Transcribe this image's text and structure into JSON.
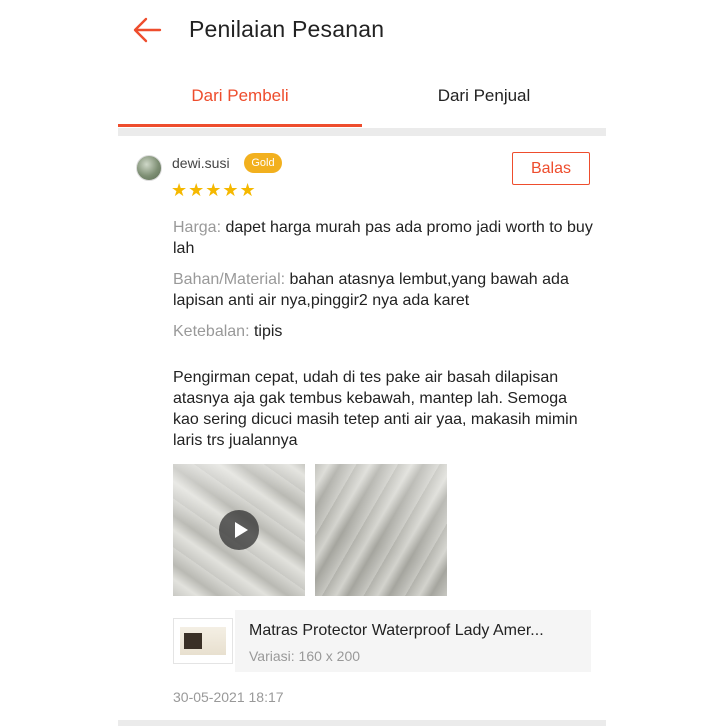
{
  "header": {
    "title": "Penilaian Pesanan",
    "back_icon": "arrow-left-icon",
    "accent_color": "#ee4d2d"
  },
  "tabs": [
    {
      "label": "Dari Pembeli",
      "active": true
    },
    {
      "label": "Dari Penjual",
      "active": false
    }
  ],
  "review": {
    "username": "dewi.susi",
    "badge": "Gold",
    "rating": 5,
    "stars": "★★★★★",
    "reply_label": "Balas",
    "attributes": [
      {
        "label": "Harga:",
        "value": "dapet harga murah pas ada promo jadi worth to buy lah"
      },
      {
        "label": "Bahan/Material:",
        "value": "bahan atasnya lembut,yang bawah ada lapisan anti air nya,pinggir2 nya ada karet"
      },
      {
        "label": "Ketebalan:",
        "value": "tipis"
      }
    ],
    "comment": "Pengirman cepat, udah di tes pake air basah dilapisan atasnya aja gak tembus kebawah, mantep lah. Semoga kao sering dicuci masih tetep anti air yaa, makasih mimin laris trs jualannya",
    "product": {
      "name": "Matras Protector Waterproof Lady Amer...",
      "variant": "Variasi: 160 x 200"
    },
    "date": "30-05-2021 18:17"
  }
}
